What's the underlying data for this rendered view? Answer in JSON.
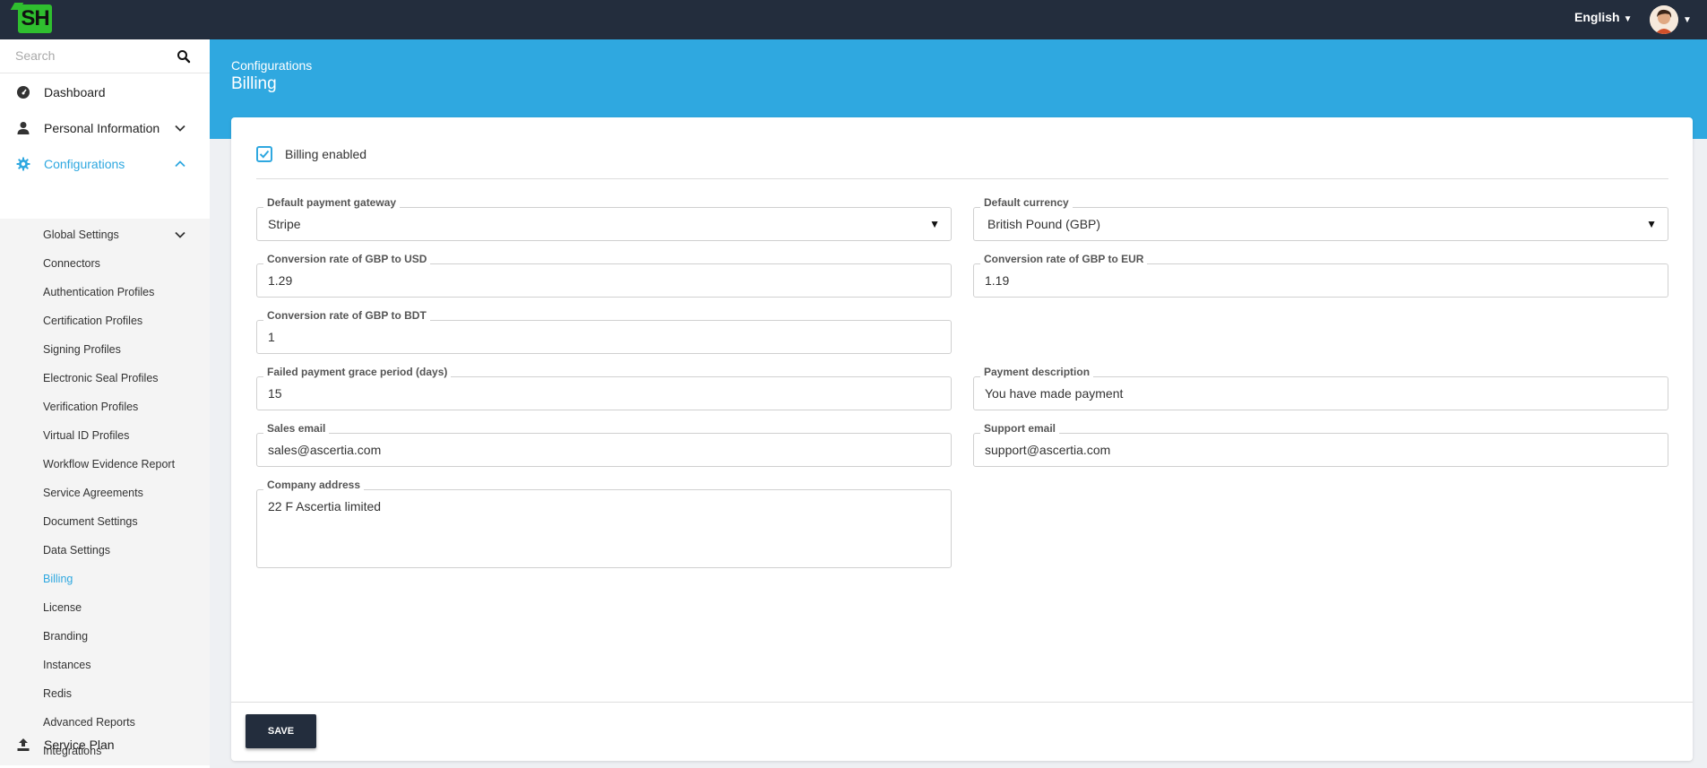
{
  "header": {
    "logo_text": "SH",
    "language": "English"
  },
  "sidebar": {
    "search_placeholder": "Search",
    "items": [
      {
        "label": "Dashboard",
        "icon": "dashboard-icon"
      },
      {
        "label": "Personal Information",
        "icon": "user-icon"
      },
      {
        "label": "Configurations",
        "icon": "gear-icon",
        "active": true
      },
      {
        "label": "Service Plan",
        "icon": "upload-icon"
      }
    ],
    "sub_items": [
      {
        "label": "Global Settings"
      },
      {
        "label": "Connectors"
      },
      {
        "label": "Authentication Profiles"
      },
      {
        "label": "Certification Profiles"
      },
      {
        "label": "Signing Profiles"
      },
      {
        "label": "Electronic Seal Profiles"
      },
      {
        "label": "Verification Profiles"
      },
      {
        "label": "Virtual ID Profiles"
      },
      {
        "label": "Workflow Evidence Report"
      },
      {
        "label": "Service Agreements"
      },
      {
        "label": "Document Settings"
      },
      {
        "label": "Data Settings"
      },
      {
        "label": "Billing",
        "active": true
      },
      {
        "label": "License"
      },
      {
        "label": "Branding"
      },
      {
        "label": "Instances"
      },
      {
        "label": "Redis"
      },
      {
        "label": "Advanced Reports"
      },
      {
        "label": "Integrations"
      }
    ]
  },
  "page": {
    "breadcrumb": "Configurations",
    "title": "Billing"
  },
  "form": {
    "billing_enabled_label": "Billing enabled",
    "billing_enabled": true,
    "payment_gateway": {
      "label": "Default payment gateway",
      "value": "Stripe"
    },
    "currency": {
      "label": "Default currency",
      "value": "British Pound (GBP)"
    },
    "rate_usd": {
      "label": "Conversion rate of GBP to USD",
      "value": "1.29"
    },
    "rate_eur": {
      "label": "Conversion rate of GBP to EUR",
      "value": "1.19"
    },
    "rate_bdt": {
      "label": "Conversion rate of GBP to BDT",
      "value": "1"
    },
    "grace_period": {
      "label": "Failed payment grace period (days)",
      "value": "15"
    },
    "payment_description": {
      "label": "Payment description",
      "value": "You have made payment"
    },
    "sales_email": {
      "label": "Sales email",
      "value": "sales@ascertia.com"
    },
    "support_email": {
      "label": "Support email",
      "value": "support@ascertia.com"
    },
    "company_address": {
      "label": "Company address",
      "value": "22 F Ascertia limited"
    },
    "save_label": "SAVE"
  },
  "colors": {
    "accent": "#2fa8e0",
    "topbar": "#232d3d",
    "logo": "#2fbf2f"
  }
}
